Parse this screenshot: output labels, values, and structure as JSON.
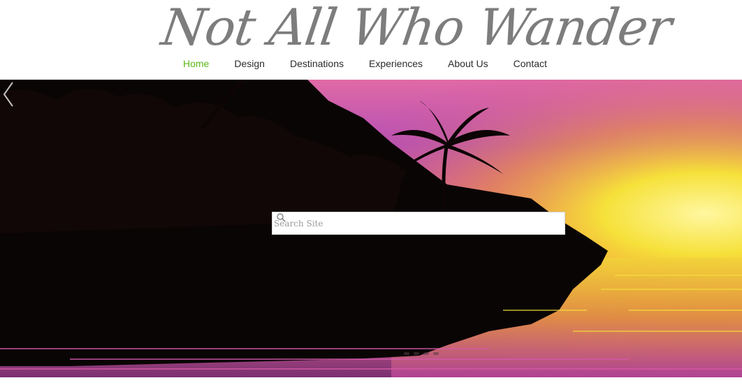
{
  "site": {
    "logo_text": "Not All Who Wander"
  },
  "nav": {
    "items": [
      {
        "label": "Home",
        "active": true
      },
      {
        "label": "Design",
        "active": false
      },
      {
        "label": "Destinations",
        "active": false
      },
      {
        "label": "Experiences",
        "active": false
      },
      {
        "label": "About Us",
        "active": false
      },
      {
        "label": "Contact",
        "active": false
      }
    ],
    "active_color": "#58b816",
    "text_color": "#2b2b2b"
  },
  "search": {
    "placeholder": "Search Site",
    "value": ""
  },
  "slideshow": {
    "image": "tropical sunset with palm tree silhouettes over water",
    "prev_icon": "chevron-left-icon",
    "slide_count": 4
  },
  "colors": {
    "logo": "#7d7d7d",
    "sky_pink": "#d85fa6",
    "sun_yellow": "#f6e13a"
  }
}
